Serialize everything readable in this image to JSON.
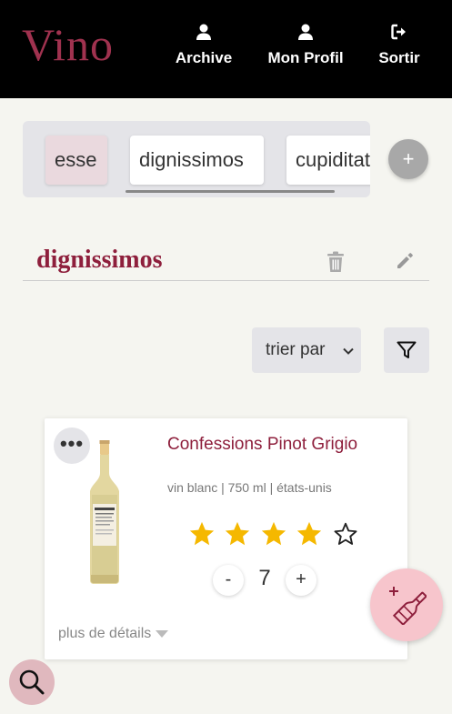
{
  "app": {
    "logo": "Vino"
  },
  "nav": {
    "archive": {
      "label": "Archive",
      "icon": "user-icon"
    },
    "profile": {
      "label": "Mon Profil",
      "icon": "user-icon"
    },
    "logout": {
      "label": "Sortir",
      "icon": "logout-icon"
    }
  },
  "tabs": [
    {
      "label": "esse",
      "active": false
    },
    {
      "label": "dignissimos",
      "active": true
    },
    {
      "label": "cupiditate"
    }
  ],
  "add_tab_label": "+",
  "list": {
    "title": "dignissimos"
  },
  "sort": {
    "label": "trier par"
  },
  "wine": {
    "more_label": "•••",
    "name": "Confessions Pinot Grigio",
    "meta": "vin blanc | 750 ml | états-unis",
    "rating": 4,
    "max_rating": 5,
    "quantity": "7",
    "minus_label": "-",
    "plus_label": "+",
    "details_label": "plus de détails"
  },
  "colors": {
    "brand": "#8e1f3c",
    "star": "#f5b800",
    "header_bg": "#000000",
    "fab": "#f7c5cc"
  }
}
